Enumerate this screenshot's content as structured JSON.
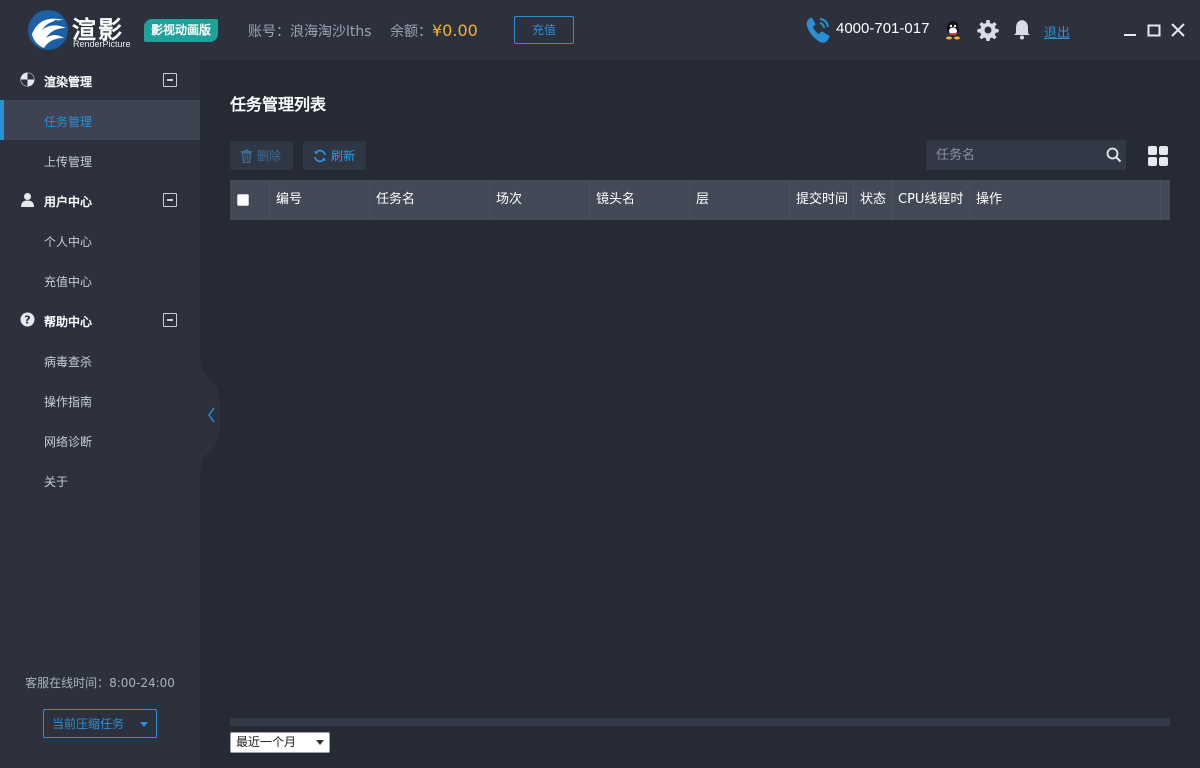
{
  "header": {
    "logo_text": "渲影",
    "logo_sub": "RenderPicture",
    "edition_badge": "影视动画版",
    "account_label": "账号：",
    "account_value": "浪海淘沙lths",
    "balance_label": "余额：",
    "balance_amount": "¥0.00",
    "recharge_button": "充值",
    "phone": "4000-701-017",
    "logout": "退出",
    "colors": {
      "accent": "#2b8fd6",
      "balance": "#f1b432",
      "badge": "#1fa29a"
    }
  },
  "sidebar": {
    "groups": [
      {
        "label": "渲染管理",
        "icon": "render-icon",
        "items": [
          {
            "label": "任务管理",
            "active": true
          },
          {
            "label": "上传管理"
          }
        ]
      },
      {
        "label": "用户中心",
        "icon": "user-icon",
        "items": [
          {
            "label": "个人中心"
          },
          {
            "label": "充值中心"
          }
        ]
      },
      {
        "label": "帮助中心",
        "icon": "help-icon",
        "items": [
          {
            "label": "病毒查杀"
          },
          {
            "label": "操作指南"
          },
          {
            "label": "网络诊断"
          },
          {
            "label": "关于"
          }
        ]
      }
    ],
    "service_hours": "客服在线时间：8:00-24:00",
    "compress_button": "当前压缩任务"
  },
  "main": {
    "title": "任务管理列表",
    "delete_button": "删除",
    "refresh_button": "刷新",
    "search_placeholder": "任务名",
    "columns": [
      "编号",
      "任务名",
      "场次",
      "镜头名",
      "层",
      "提交时间",
      "状态",
      "CPU线程时",
      "操作"
    ],
    "period_select": "最近一个月"
  }
}
